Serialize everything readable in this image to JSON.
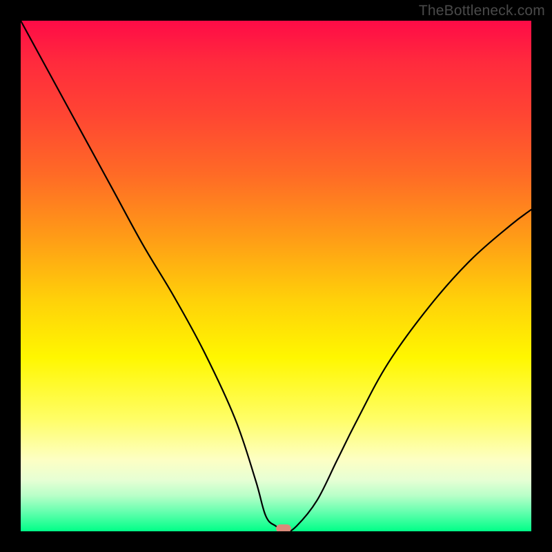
{
  "watermark": "TheBottleneck.com",
  "chart_data": {
    "type": "line",
    "title": "",
    "xlabel": "",
    "ylabel": "",
    "xlim": [
      0,
      100
    ],
    "ylim": [
      0,
      100
    ],
    "grid": false,
    "series": [
      {
        "name": "bottleneck_curve",
        "x": [
          0,
          6,
          12,
          18,
          24,
          30,
          36,
          42,
          46,
          48,
          50,
          52,
          54,
          58,
          62,
          66,
          72,
          80,
          88,
          96,
          100
        ],
        "values": [
          100,
          89,
          78,
          67,
          56,
          46,
          35,
          22,
          10,
          3,
          1,
          0,
          1,
          6,
          14,
          22,
          33,
          44,
          53,
          60,
          63
        ]
      }
    ],
    "marker": {
      "x": 51.5,
      "y": 0.5
    },
    "background_gradient": {
      "orientation": "vertical",
      "stops": [
        {
          "pos": 0.0,
          "color": "#ff0b47"
        },
        {
          "pos": 0.3,
          "color": "#ff6a26"
        },
        {
          "pos": 0.55,
          "color": "#ffd209"
        },
        {
          "pos": 0.78,
          "color": "#fffe66"
        },
        {
          "pos": 1.0,
          "color": "#00ff88"
        }
      ]
    }
  }
}
